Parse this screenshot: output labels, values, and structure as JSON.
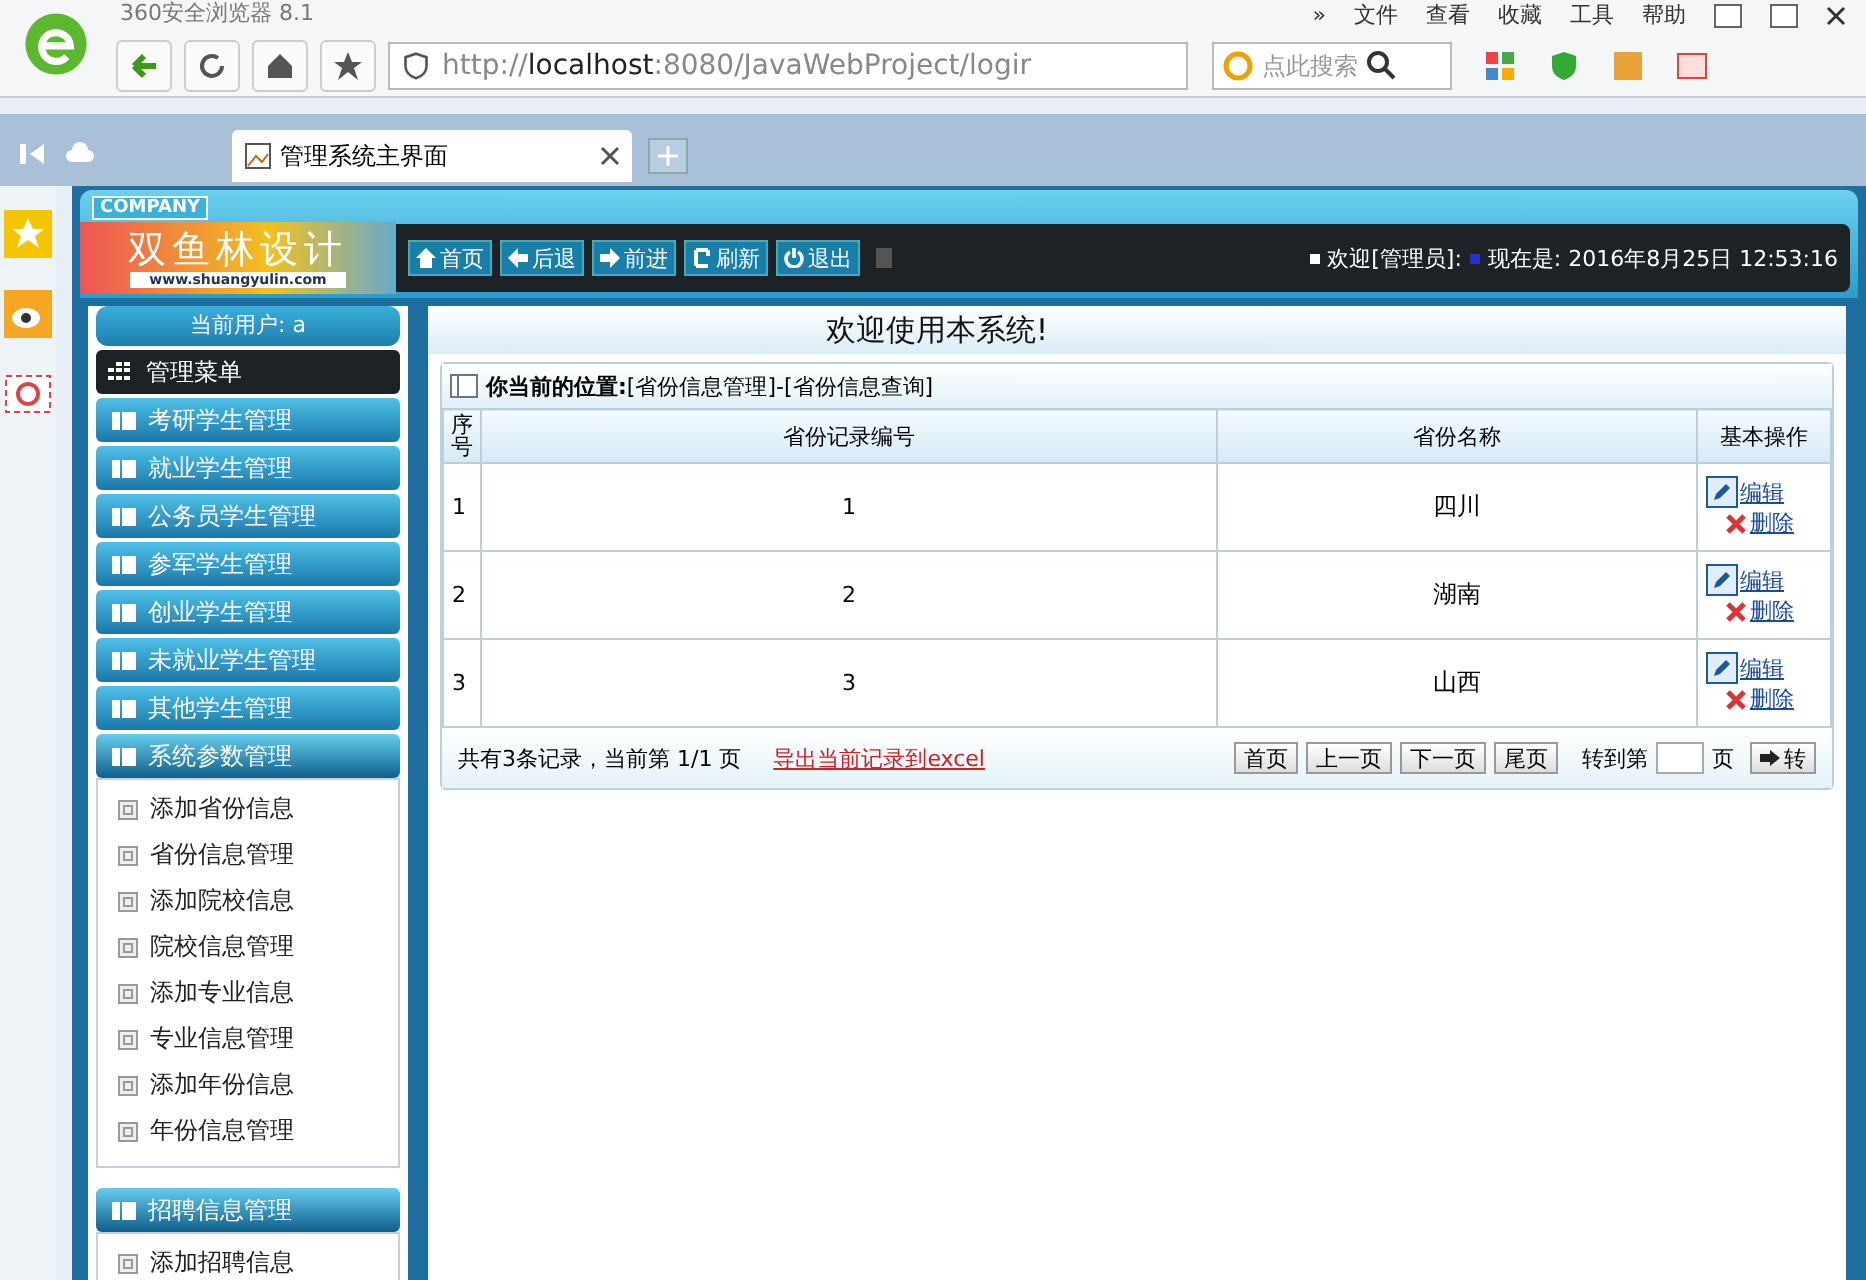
{
  "browser": {
    "title": "360安全浏览器 8.1",
    "menu": [
      "»",
      "文件",
      "查看",
      "收藏",
      "工具",
      "帮助"
    ],
    "url_host": "localhost",
    "url_prefix": "http://",
    "url_rest": ":8080/JavaWebProject/logir",
    "search_placeholder": "点此搜索",
    "tab": {
      "label": "管理系统主界面",
      "selected": true
    }
  },
  "header": {
    "company": "COMPANY",
    "logo_text": "双鱼林设计",
    "logo_url": "www.shuangyulin.com",
    "nav": [
      "首页",
      "后退",
      "前进",
      "刷新",
      "退出"
    ],
    "welcome": "欢迎[管理员]:",
    "datetime": "现在是: 2016年8月25日 12:53:16"
  },
  "sidebar": {
    "current_user": "当前用户: a",
    "menu_title": "管理菜单",
    "groups": [
      {
        "label": "考研学生管理",
        "expanded": false
      },
      {
        "label": "就业学生管理",
        "expanded": false
      },
      {
        "label": "公务员学生管理",
        "expanded": false
      },
      {
        "label": "参军学生管理",
        "expanded": false
      },
      {
        "label": "创业学生管理",
        "expanded": false
      },
      {
        "label": "未就业学生管理",
        "expanded": false
      },
      {
        "label": "其他学生管理",
        "expanded": false
      },
      {
        "label": "系统参数管理",
        "expanded": true,
        "children": [
          "添加省份信息",
          "省份信息管理",
          "添加院校信息",
          "院校信息管理",
          "添加专业信息",
          "专业信息管理",
          "添加年份信息",
          "年份信息管理"
        ]
      },
      {
        "label": "招聘信息管理",
        "expanded": true,
        "children": [
          "添加招聘信息"
        ]
      }
    ]
  },
  "banner": "欢迎使用本系统!",
  "breadcrumb": {
    "label": "你当前的位置:",
    "path": "[省份信息管理]-[省份信息查询]"
  },
  "table": {
    "columns": [
      "序号",
      "省份记录编号",
      "省份名称",
      "基本操作"
    ],
    "rows": [
      {
        "index": "1",
        "id": "1",
        "name": "四川",
        "actions": [
          "编辑",
          "删除"
        ]
      },
      {
        "index": "2",
        "id": "2",
        "name": "湖南",
        "actions": [
          "编辑",
          "删除"
        ]
      },
      {
        "index": "3",
        "id": "3",
        "name": "山西",
        "actions": [
          "编辑",
          "删除"
        ]
      }
    ]
  },
  "footer": {
    "summary": "共有3条记录，当前第 1/1 页",
    "export_link": "导出当前记录到excel",
    "pager": [
      "首页",
      "上一页",
      "下一页",
      "尾页"
    ],
    "goto_label": "转到第",
    "page_suffix": "页",
    "go_button": "转"
  }
}
